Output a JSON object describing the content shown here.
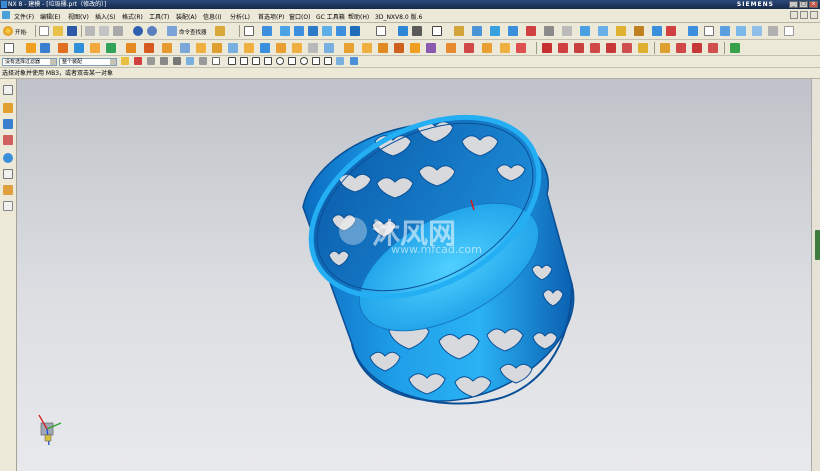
{
  "window": {
    "title": "NX 8 - 建模 - [垃圾桶.prt（修改的）]",
    "brand": "SIEMENS",
    "buttons": [
      "_",
      "□",
      "×"
    ]
  },
  "menu": {
    "items": [
      "文件(F)",
      "编辑(E)",
      "视图(V)",
      "插入(S)",
      "格式(R)",
      "工具(T)",
      "装配(A)",
      "信息(I)",
      "分析(L)",
      "首选项(P)",
      "窗口(O)",
      "GC 工具箱",
      "帮助(H)"
    ],
    "version_label": "3D_NXV8.0 版.6"
  },
  "toolbar": {
    "start_label": "开始·",
    "command_finder_label": "命令查找器"
  },
  "selection": {
    "filter_value": "没有选择过滤器",
    "scope_value": "整个装配"
  },
  "prompt": {
    "text": "选择对象并使用 MB3，或者双击某一对象"
  },
  "watermark": {
    "brand_text": "沐风网",
    "url_text": "www.mfcad.com"
  },
  "colors": {
    "part_blue": "#1aa3ec",
    "part_dark": "#0a5ea8",
    "titlebar": "#1c3560",
    "toolbar_bg": "#ece9d8"
  },
  "icons": [
    "start-icon",
    "new-file-icon",
    "open-icon",
    "save-icon",
    "cut-icon",
    "copy-icon",
    "paste-icon",
    "undo-icon",
    "redo-icon",
    "command-finder-icon",
    "fit-icon",
    "zoom-icon",
    "rotate-icon",
    "pan-icon",
    "shaded-view-icon",
    "wireframe-icon",
    "sketch-icon",
    "extrude-icon",
    "revolve-icon",
    "hole-icon",
    "boss-icon",
    "blend-icon",
    "chamfer-icon",
    "shell-icon",
    "trim-icon",
    "pattern-icon",
    "snap-endpoint-icon",
    "snap-midpoint-icon",
    "snap-center-icon",
    "part-navigator-icon",
    "assembly-navigator-icon",
    "history-icon",
    "roles-icon",
    "wcs-triad-icon"
  ]
}
